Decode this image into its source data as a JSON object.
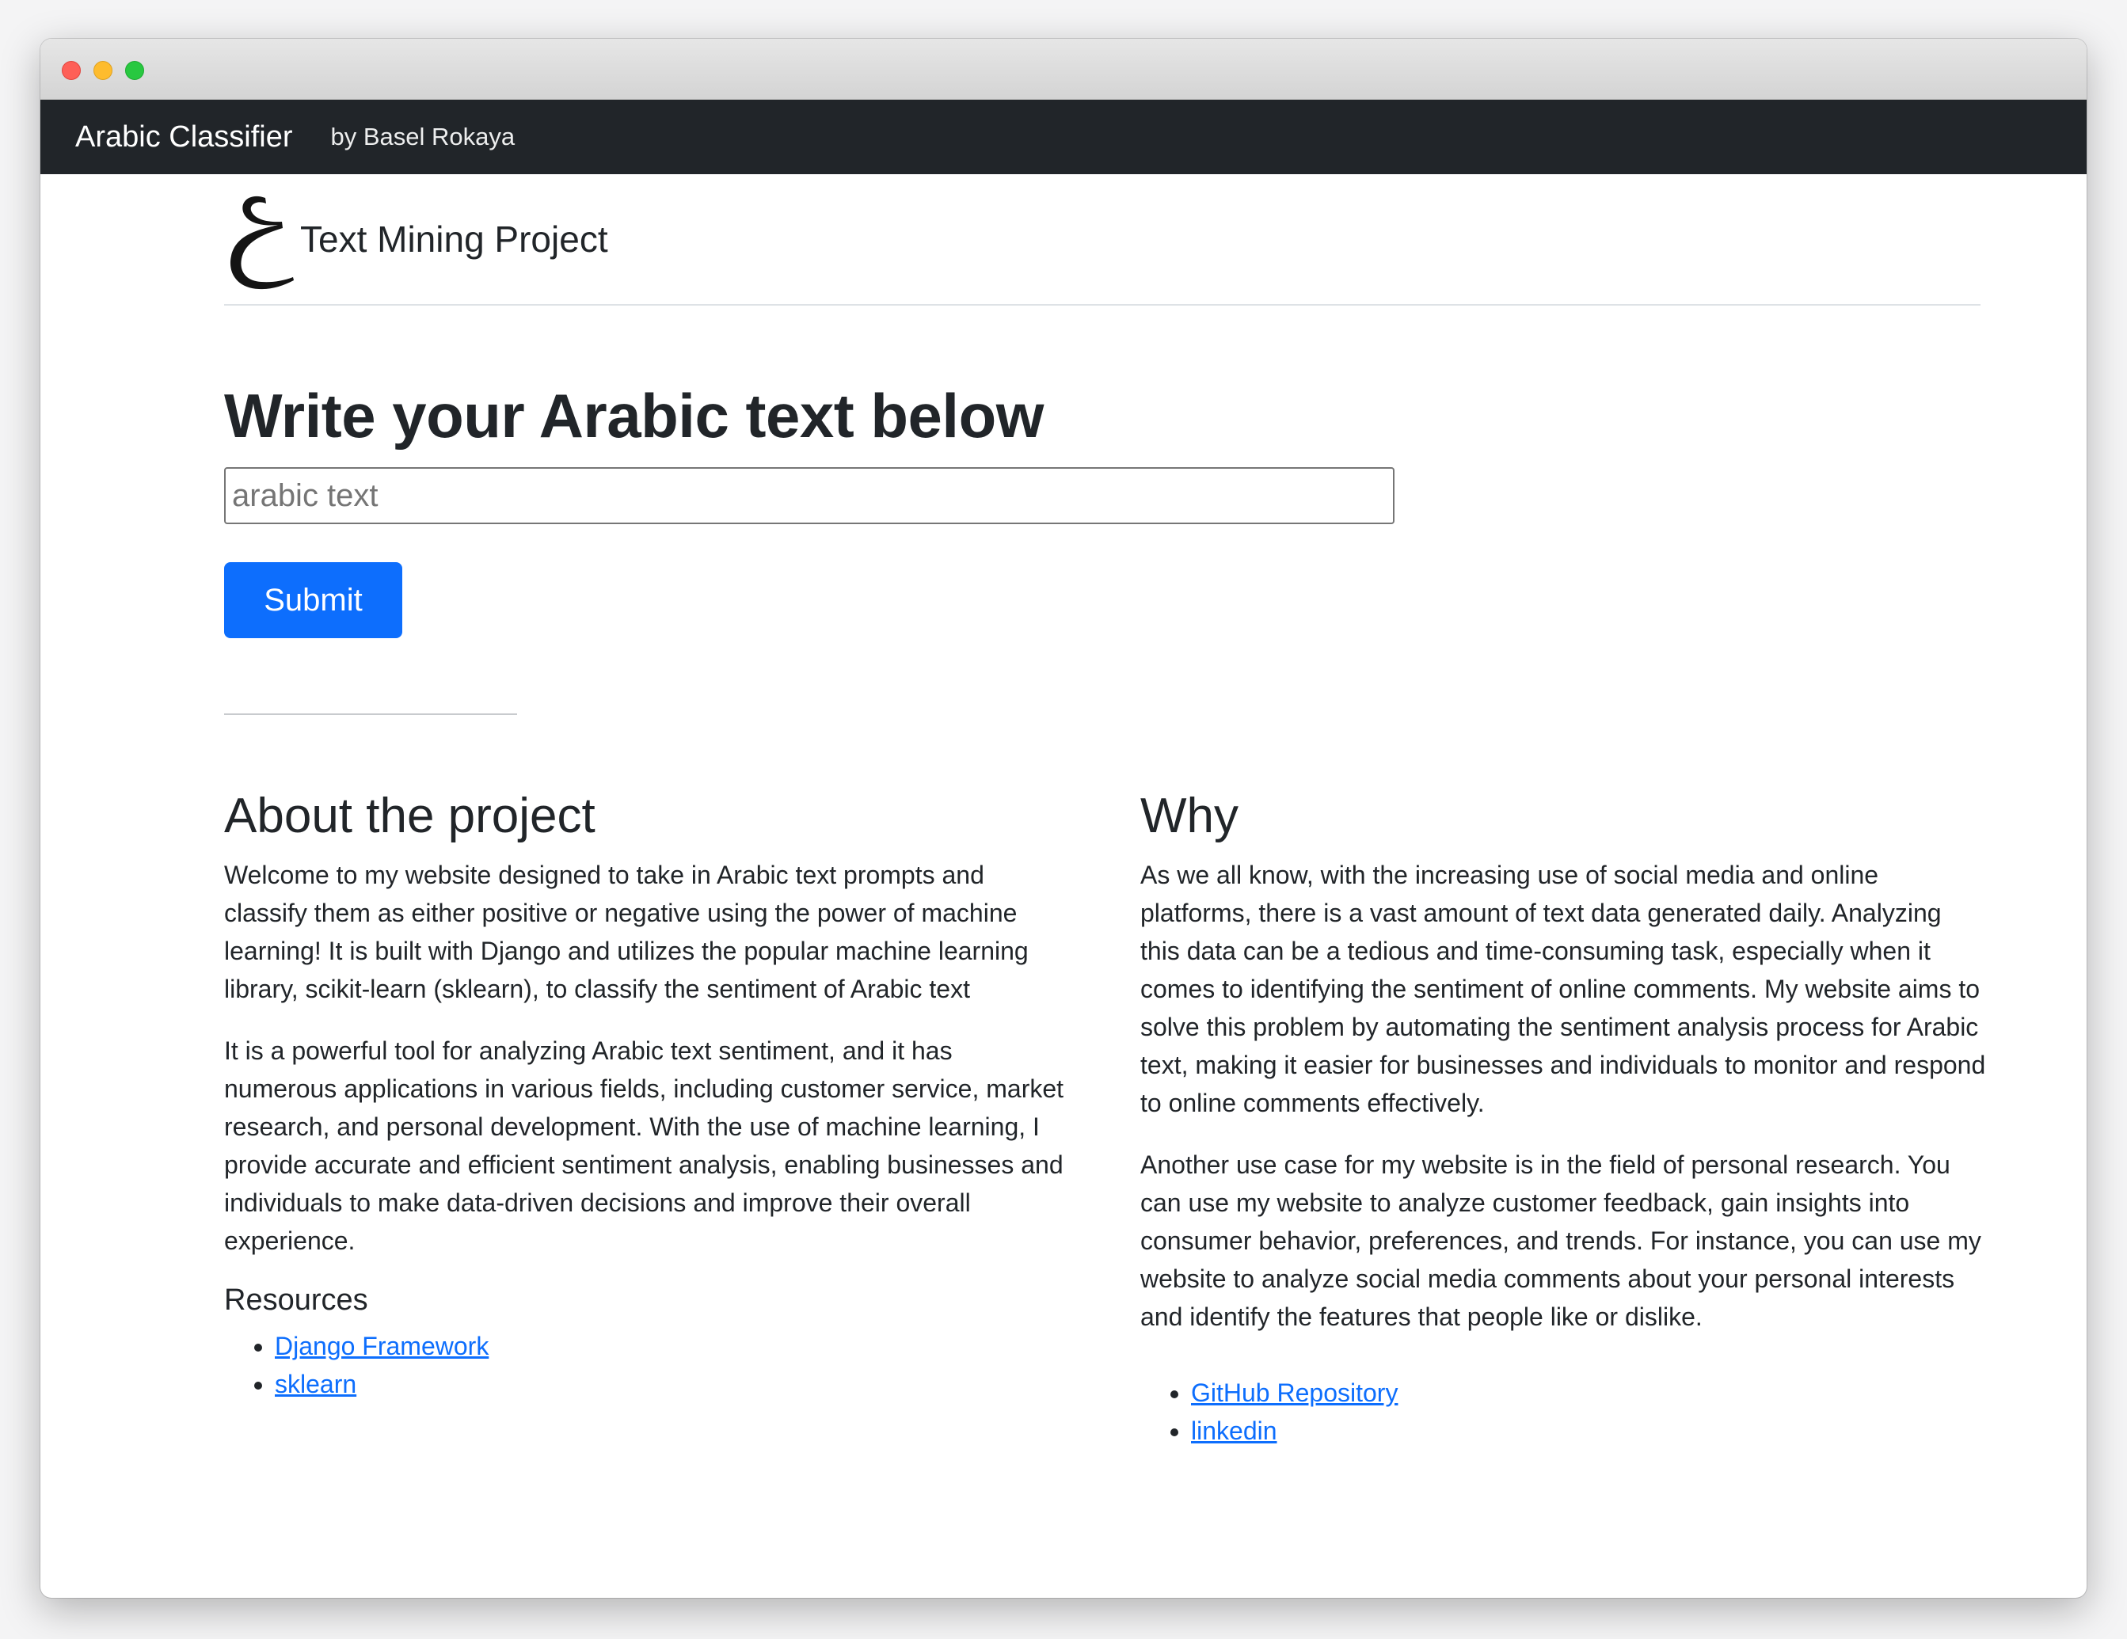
{
  "navbar": {
    "brand": "Arabic Classifier",
    "author_link": "by Basel Rokaya"
  },
  "header": {
    "logo_glyph": "ع",
    "title": "Text Mining Project"
  },
  "form": {
    "heading": "Write your Arabic text below",
    "input_placeholder": "arabic text",
    "input_value": "",
    "submit_label": "Submit"
  },
  "about": {
    "heading": "About the project",
    "paragraphs": [
      "Welcome to my website designed to take in Arabic text prompts and classify them as either positive or negative using the power of machine learning! It is built with Django and utilizes the popular machine learning library, scikit-learn (sklearn), to classify the sentiment of Arabic text",
      "It is a powerful tool for analyzing Arabic text sentiment, and it has numerous applications in various fields, including customer service, market research, and personal development. With the use of machine learning, I provide accurate and efficient sentiment analysis, enabling businesses and individuals to make data-driven decisions and improve their overall experience."
    ],
    "resources_heading": "Resources",
    "links": [
      "Django Framework",
      "sklearn"
    ]
  },
  "why": {
    "heading": "Why",
    "paragraphs": [
      "As we all know, with the increasing use of social media and online platforms, there is a vast amount of text data generated daily. Analyzing this data can be a tedious and time-consuming task, especially when it comes to identifying the sentiment of online comments. My website aims to solve this problem by automating the sentiment analysis process for Arabic text, making it easier for businesses and individuals to monitor and respond to online comments effectively.",
      "Another use case for my website is in the field of personal research. You can use my website to analyze customer feedback, gain insights into consumer behavior, preferences, and trends. For instance, you can use my website to analyze social media comments about your personal interests and identify the features that people like or dislike."
    ],
    "links": [
      "GitHub Repository",
      "linkedin"
    ]
  },
  "colors": {
    "navbar_bg": "#212529",
    "primary": "#0d6efd",
    "link": "#0d6efd"
  }
}
